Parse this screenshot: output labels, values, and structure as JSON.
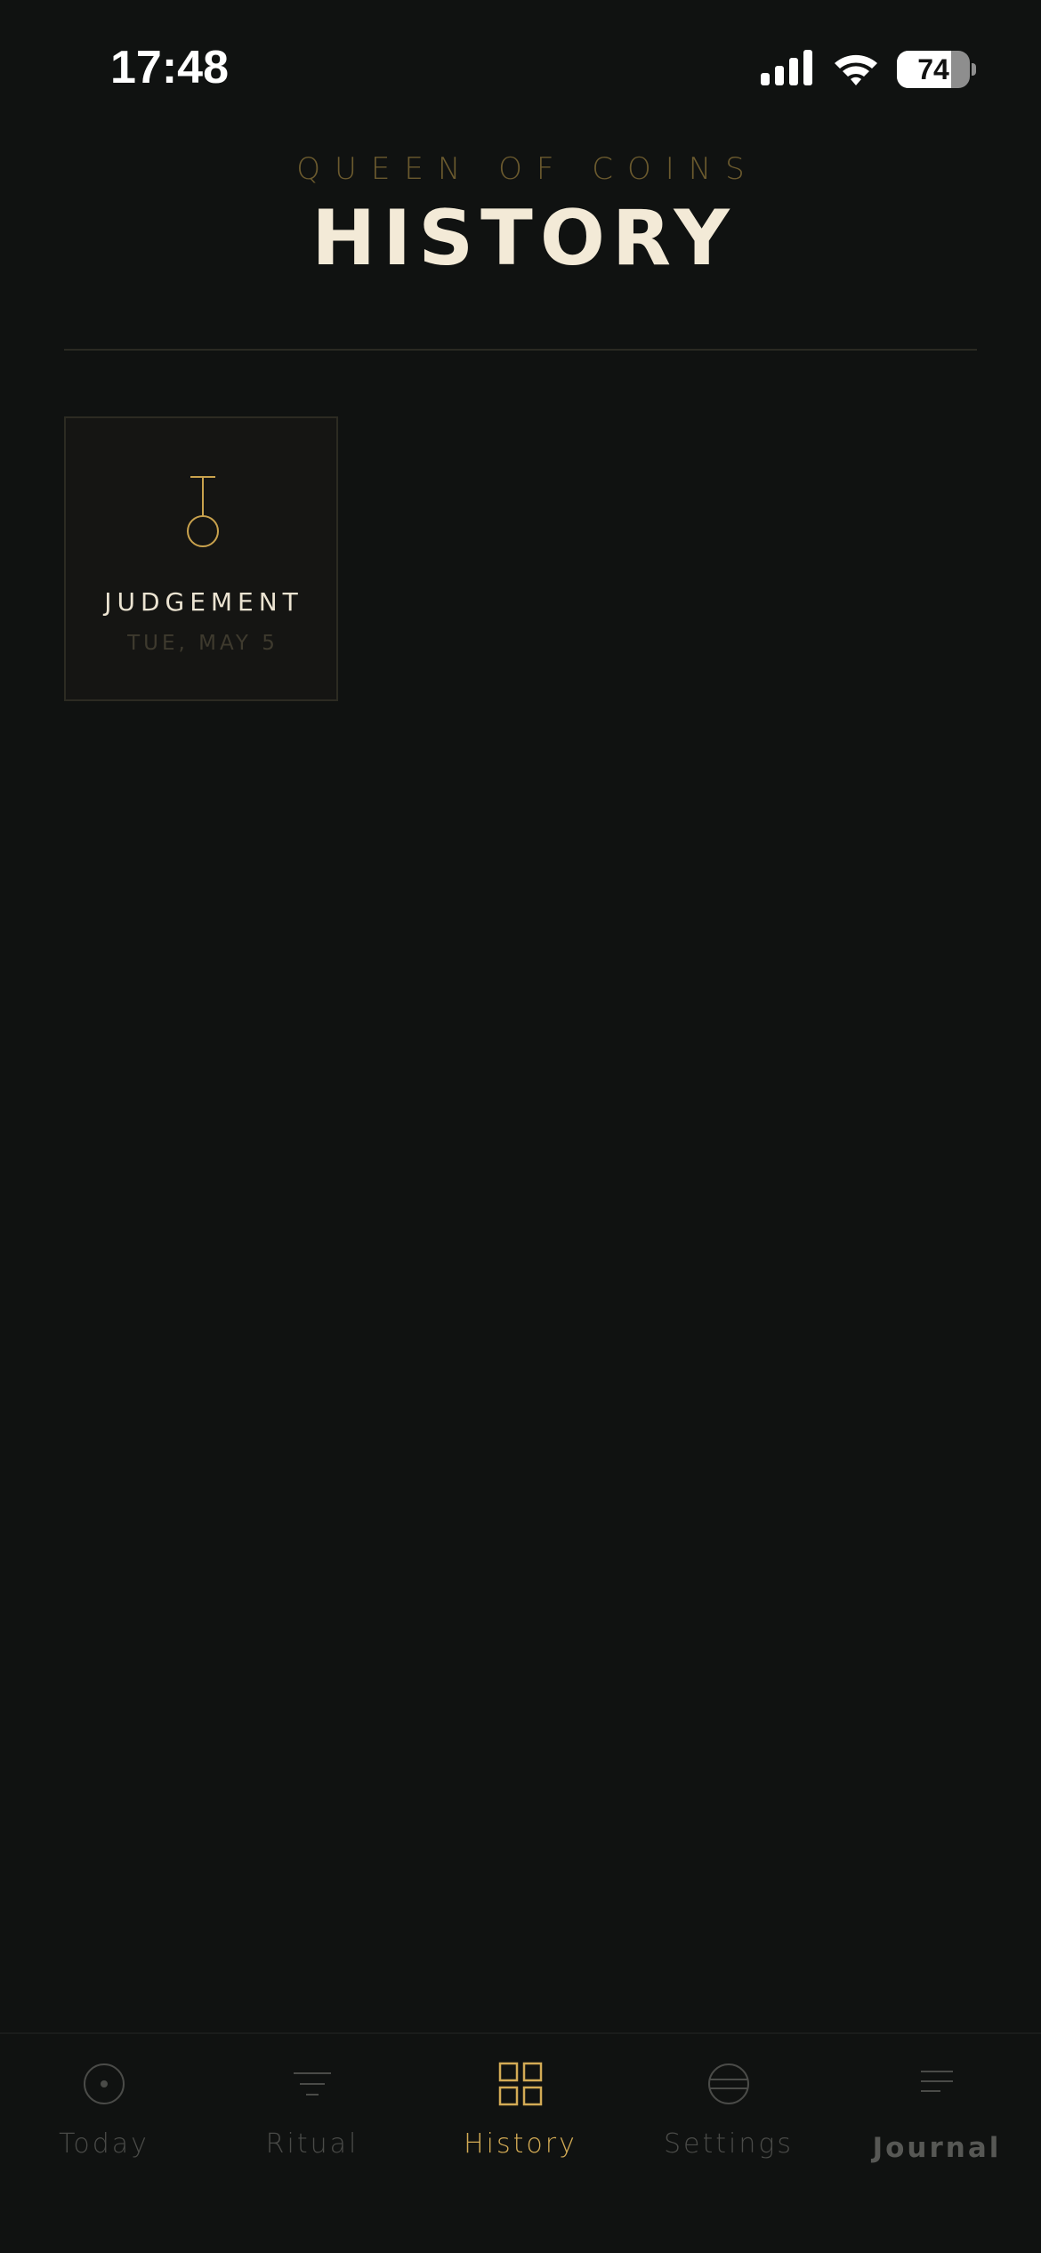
{
  "status_bar": {
    "time": "17:48",
    "battery_level": "74",
    "battery_fraction": 0.74,
    "icons": [
      "cellular-signal-icon",
      "wifi-icon",
      "battery-icon"
    ]
  },
  "header": {
    "eyebrow": "QUEEN OF COINS",
    "title": "HISTORY"
  },
  "history": {
    "items": [
      {
        "card_name": "JUDGEMENT",
        "date": "TUE, MAY 5",
        "icon": "judgement-glyph-icon"
      }
    ]
  },
  "tab_bar": {
    "active": "History",
    "tabs": [
      {
        "label": "Today",
        "icon": "dot-circle-icon"
      },
      {
        "label": "Ritual",
        "icon": "lines-funnel-icon"
      },
      {
        "label": "History",
        "icon": "grid-icon"
      },
      {
        "label": "Settings",
        "icon": "circle-lines-icon"
      },
      {
        "label": "Journal",
        "icon": "text-lines-icon"
      }
    ]
  },
  "colors": {
    "background": "#101211",
    "accent_gold": "#d3ab55",
    "title_cream": "#f3ead7",
    "eyebrow_gold": "#6b5a2e",
    "inactive_tab": "#4a4b48"
  }
}
